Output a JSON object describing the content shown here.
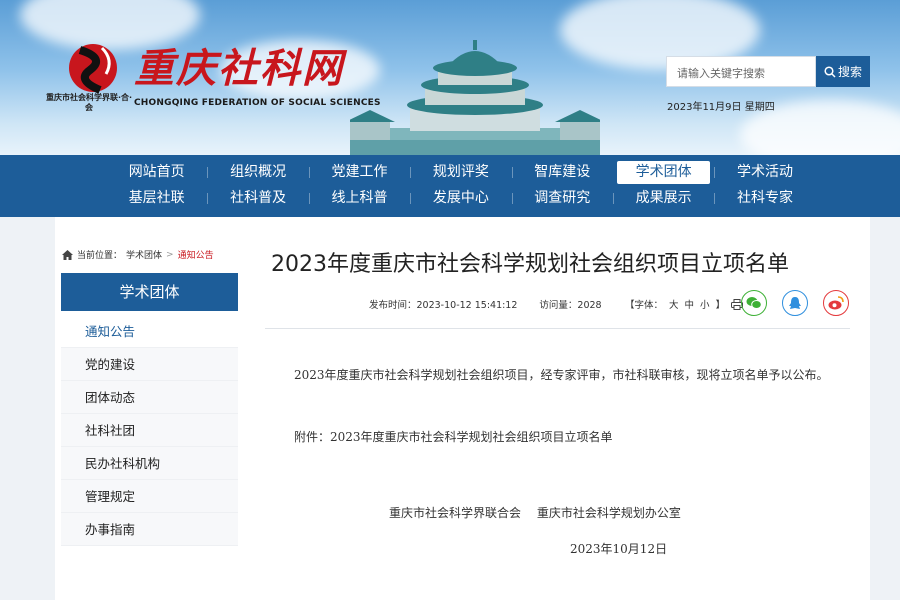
{
  "header": {
    "logo_org": "重庆市社会科学界联·合·会",
    "site_title": "重庆社科网",
    "site_en": "CHONGQING FEDERATION OF SOCIAL SCIENCES",
    "search_placeholder": "请输入关键字搜索",
    "search_button": "搜索",
    "date": "2023年11月9日 星期四"
  },
  "nav": {
    "row1": [
      "网站首页",
      "组织概况",
      "党建工作",
      "规划评奖",
      "智库建设",
      "学术团体",
      "学术活动"
    ],
    "row2": [
      "基层社联",
      "社科普及",
      "线上科普",
      "发展中心",
      "调查研究",
      "成果展示",
      "社科专家"
    ],
    "active": "学术团体"
  },
  "breadcrumb": {
    "prefix": "当前位置：",
    "items": [
      "学术团体",
      "通知公告"
    ],
    "separator": ">"
  },
  "sidebar": {
    "title": "学术团体",
    "items": [
      "通知公告",
      "党的建设",
      "团体动态",
      "社科社团",
      "民办社科机构",
      "管理规定",
      "办事指南"
    ]
  },
  "article": {
    "title": "2023年度重庆市社会科学规划社会组织项目立项名单",
    "publish_time": "发布时间：2023-10-12 15:41:12",
    "views": "访问量：2028",
    "font_label": "【字体：",
    "font_sizes": [
      "大",
      "中",
      "小"
    ],
    "font_close": "】",
    "paragraph1": "2023年度重庆市社会科学规划社会组织项目，经专家评审，市社科联审核，现将立项名单予以公布。",
    "attachment": "附件：2023年度重庆市社会科学规划社会组织项目立项名单",
    "signatures": "重庆市社会科学界联合会　 重庆市社会科学规划办公室",
    "sign_date": "2023年10月12日"
  },
  "colors": {
    "primary": "#1d5d99",
    "accent_red": "#c8161d",
    "wechat": "#3db035",
    "qq": "#2f8fde",
    "weibo": "#e4393c"
  },
  "icons": [
    "home-icon",
    "search-icon",
    "print-icon",
    "wechat-icon",
    "qq-icon",
    "weibo-icon"
  ]
}
